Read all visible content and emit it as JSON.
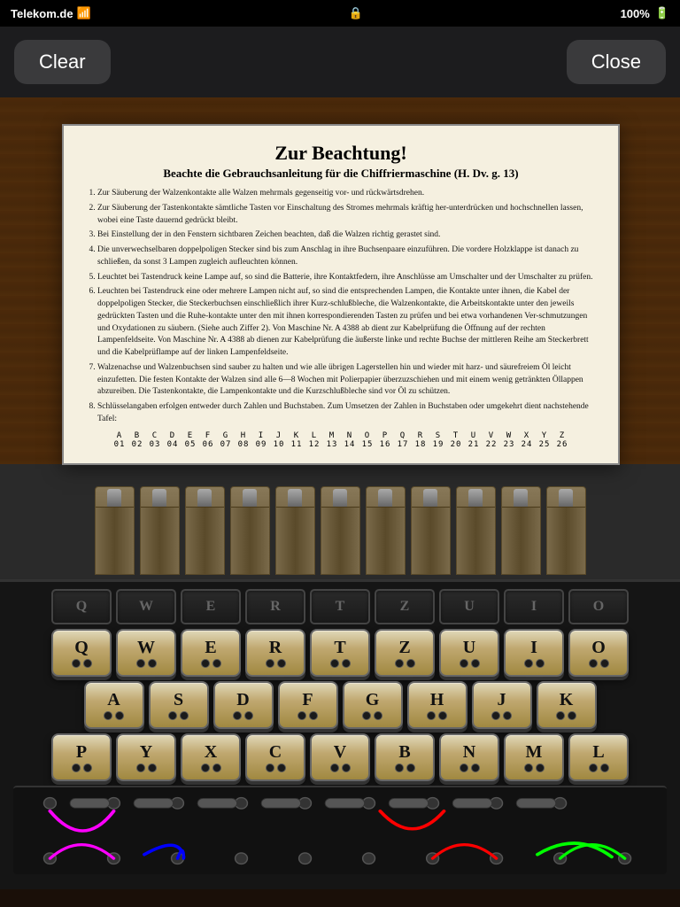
{
  "statusBar": {
    "carrier": "Telekom.de",
    "signal": "●●●●",
    "wifi": "wifi",
    "battery": "100%",
    "lock": "🔒"
  },
  "topBar": {
    "clearLabel": "Clear",
    "closeLabel": "Close"
  },
  "instructionCard": {
    "title": "Zur Beachtung!",
    "subtitle": "Beachte die Gebrauchsanleitung für die Chiffriermaschine (H. Dv. g. 13)",
    "items": [
      "Zur Säuberung der Walzenkontakte alle Walzen mehrmals gegenseitig vor- und rückwärtsdrehen.",
      "Zur Säuberung der Tastenkontakte sämtliche Tasten vor Einschaltung des Stromes mehrmals kräftig her-unterdrücken und hochschnellen lassen, wobei eine Taste dauernd gedrückt bleibt.",
      "Bei Einstellung der in den Fenstern sichtbaren Zeichen beachten, daß die Walzen richtig gerastet sind.",
      "Die unverwechselbaren doppelpoligen Stecker sind bis zum Anschlag in ihre Buchsenpaare einzuführen. Die vordere Holzklappe ist danach zu schließen, da sonst 3 Lampen zugleich aufleuchten können.",
      "Leuchtet bei Tastendruck keine Lampe auf, so sind die Batterie, ihre Kontaktfedern, ihre Anschlüsse am Umschalter und der Umschalter zu prüfen.",
      "Leuchten bei Tastendruck eine oder mehrere Lampen nicht auf, so sind die entsprechenden Lampen, die Kontakte unter ihnen, die Kabel der doppelpoligen Stecker, die Steckerbuchsen einschließlich ihrer Kurz-schlußbleche, die Walzenkontakte, die Arbeitskontakte unter den jeweils gedrückten Tasten und die Ruhe-kontakte unter den mit ihnen korrespondierenden Tasten zu prüfen und bei etwa vorhandenen Ver-schmutzungen und Oxydationen zu säubern. (Siehe auch Ziffer 2). Von Maschine Nr. A 4388 ab dient zur Kabelprüfung die Öffnung auf der rechten Lampenfeldseite. Von Maschine Nr. A 4388 ab dienen zur Kabelprüfung die äußerste linke und rechte Buchse der mittleren Reihe am Steckerbrett und die Kabelprüflampe auf der linken Lampenfeldseite.",
      "Walzenachse und Walzenbuchsen sind sauber zu halten und wie alle übrigen Lagerstellen hin und wieder mit harz- und säurefreiem Öl leicht einzufetten. Die festen Kontakte der Walzen sind alle 6—8 Wochen mit Polierpapier überzuzschiehen und mit einem wenig getränkten Öllappen abzureiben. Die Tastenkontakte, die Lampenkontakte und die Kurzschlußbleche sind vor Öl zu schützen.",
      "Schlüsselangaben erfolgen entweder durch Zahlen und Buchstaben. Zum Umsetzen der Zahlen in Buchstaben oder umgekehrt dient nachstehende Tafel:"
    ],
    "letterRow": "A B C D E F G H I J K L M N O P Q R S T U V W X Y Z",
    "numberRow": "01 02 03 04 05 06 07 08 09 10 11 12 13 14 15 16 17 18 19 20 21 22 23 24 25 26"
  },
  "keyboard": {
    "row1": [
      "Q",
      "W",
      "E",
      "R",
      "T",
      "Z",
      "U",
      "I",
      "O"
    ],
    "row2": [
      "A",
      "S",
      "D",
      "F",
      "G",
      "H",
      "J",
      "K"
    ],
    "row3": [
      "P",
      "Y",
      "X",
      "C",
      "V",
      "B",
      "N",
      "M",
      "L"
    ],
    "plugConnections": [
      {
        "from": "P",
        "to": "Y",
        "color": "magenta"
      },
      {
        "from": "B",
        "to": "N",
        "color": "red"
      },
      {
        "from": "X",
        "to": "X",
        "color": "blue"
      },
      {
        "from": "L",
        "to": "M",
        "color": "green"
      }
    ]
  },
  "colors": {
    "wood": "#4a2a0a",
    "machineBody": "#1a1a1a",
    "keyBackground": "#c8b890",
    "accent": "#2a2a2a"
  }
}
